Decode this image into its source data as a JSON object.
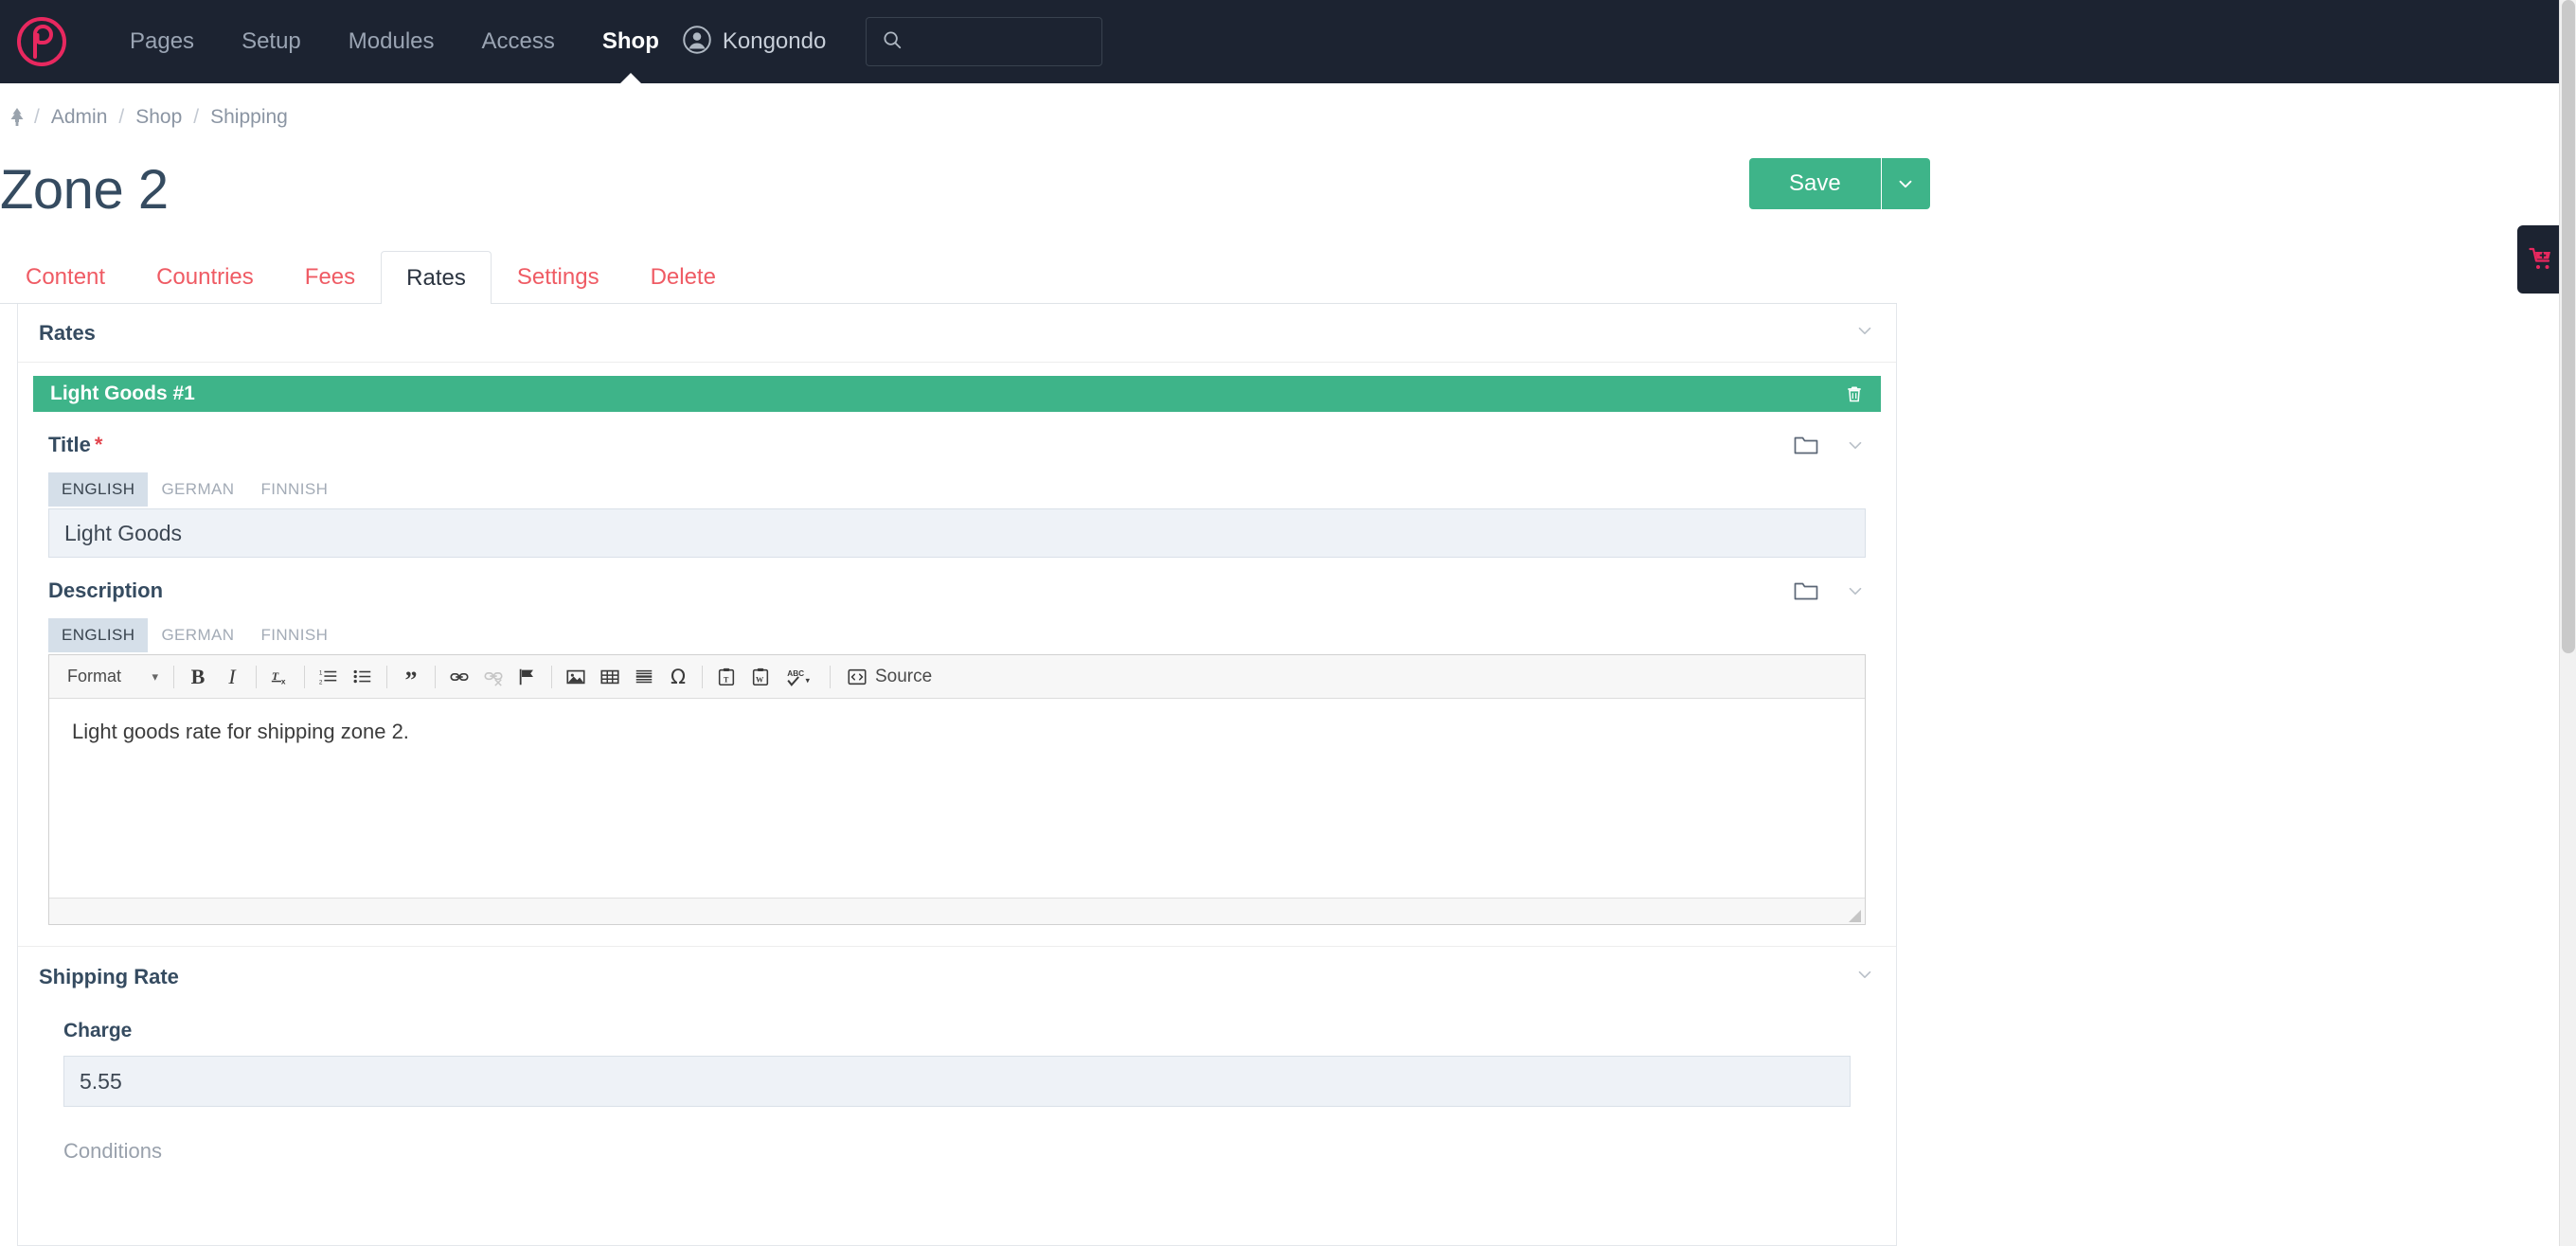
{
  "masthead": {
    "logo_icon": "processwire-logo-icon",
    "nav": [
      {
        "label": "Pages",
        "active": false
      },
      {
        "label": "Setup",
        "active": false
      },
      {
        "label": "Modules",
        "active": false
      },
      {
        "label": "Access",
        "active": false
      },
      {
        "label": "Shop",
        "active": true
      }
    ],
    "user": {
      "name": "Kongondo",
      "avatar_icon": "user-circle-icon"
    },
    "search": {
      "value": "",
      "placeholder": "",
      "icon": "search-icon"
    }
  },
  "breadcrumb": {
    "home_icon": "tree-home-icon",
    "items": [
      "Admin",
      "Shop",
      "Shipping"
    ],
    "separator": "/"
  },
  "header": {
    "title": "Zone 2",
    "save_label": "Save",
    "save_caret_icon": "chevron-down-icon"
  },
  "tabs": [
    {
      "label": "Content",
      "active": false
    },
    {
      "label": "Countries",
      "active": false
    },
    {
      "label": "Fees",
      "active": false
    },
    {
      "label": "Rates",
      "active": true
    },
    {
      "label": "Settings",
      "active": false
    },
    {
      "label": "Delete",
      "active": false
    }
  ],
  "rates_section": {
    "title": "Rates",
    "toggle_icon": "chevron-down-icon"
  },
  "rate_bar": {
    "title": "Light Goods #1",
    "delete_icon": "trash-icon"
  },
  "title_field": {
    "label": "Title",
    "required_marker": "*",
    "folder_icon": "folder-icon",
    "toggle_icon": "chevron-down-icon",
    "languages": [
      {
        "label": "ENGLISH",
        "active": true
      },
      {
        "label": "GERMAN",
        "active": false
      },
      {
        "label": "FINNISH",
        "active": false
      }
    ],
    "value": "Light Goods",
    "placeholder": ""
  },
  "description_field": {
    "label": "Description",
    "folder_icon": "folder-icon",
    "toggle_icon": "chevron-down-icon",
    "languages": [
      {
        "label": "ENGLISH",
        "active": true
      },
      {
        "label": "GERMAN",
        "active": false
      },
      {
        "label": "FINNISH",
        "active": false
      }
    ],
    "editor": {
      "format_label": "Format",
      "format_caret_icon": "caret-down-icon",
      "source_label": "Source",
      "buttons": [
        {
          "name": "bold-icon",
          "glyph": "B",
          "enabled": true
        },
        {
          "name": "italic-icon",
          "glyph": "I",
          "enabled": true
        },
        {
          "name": "remove-format-icon",
          "glyph": "Tx",
          "enabled": true
        },
        {
          "name": "numbered-list-icon",
          "glyph": "1=",
          "enabled": true
        },
        {
          "name": "bulleted-list-icon",
          "glyph": "•=",
          "enabled": true
        },
        {
          "name": "blockquote-icon",
          "glyph": "”",
          "enabled": true
        },
        {
          "name": "link-icon",
          "glyph": "link",
          "enabled": true
        },
        {
          "name": "unlink-icon",
          "glyph": "unlink",
          "enabled": false
        },
        {
          "name": "anchor-flag-icon",
          "glyph": "flag",
          "enabled": true
        },
        {
          "name": "image-icon",
          "glyph": "image",
          "enabled": true
        },
        {
          "name": "table-icon",
          "glyph": "table",
          "enabled": true
        },
        {
          "name": "horizontal-rule-icon",
          "glyph": "hr",
          "enabled": true
        },
        {
          "name": "special-character-icon",
          "glyph": "Ω",
          "enabled": true
        },
        {
          "name": "paste-as-text-icon",
          "glyph": "pasteT",
          "enabled": true
        },
        {
          "name": "paste-from-word-icon",
          "glyph": "pasteW",
          "enabled": true
        },
        {
          "name": "spell-check-icon",
          "glyph": "ABC",
          "enabled": true
        }
      ],
      "content": "Light goods rate for shipping zone 2."
    }
  },
  "shipping_rate_section": {
    "title": "Shipping Rate",
    "toggle_icon": "chevron-down-icon",
    "charge_label": "Charge",
    "charge_value": "5.55",
    "charge_placeholder": "",
    "conditions_label": "Conditions"
  },
  "cart_tab": {
    "icon": "cart-plus-icon"
  },
  "colors": {
    "masthead_bg": "#1c2331",
    "brand_pink": "#e8285f",
    "accent_green": "#3eb489",
    "tab_red": "#ef5b64",
    "heading_navy": "#354b60",
    "input_bg": "#eef2f7"
  }
}
